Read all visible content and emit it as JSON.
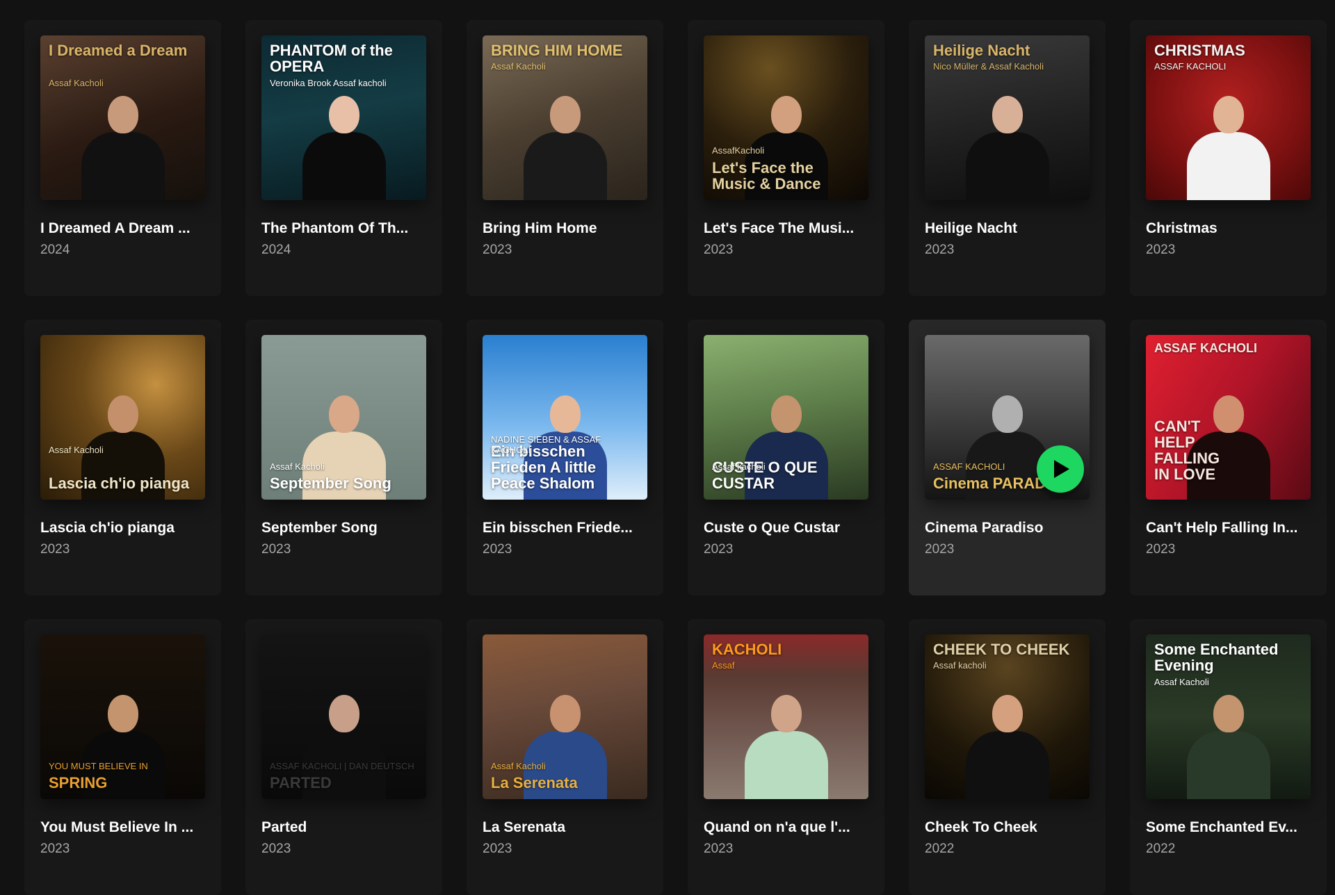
{
  "albums": [
    {
      "title": "I Dreamed A Dream ...",
      "year": "2024",
      "cover_text": "I Dreamed a Dream",
      "cover_sub": "Assaf Kacholi",
      "bg": "linear-gradient(160deg,#5a4030 0%,#2a1a12 55%,#15100c 100%)",
      "text_color": "#d9b56a",
      "skin": "#c79a7c",
      "suit": "#111111",
      "text_pos": "top"
    },
    {
      "title": "The Phantom Of Th...",
      "year": "2024",
      "cover_text": "PHANTOM of the OPERA",
      "cover_sub": "Veronika Brook   Assaf kacholi",
      "bg": "linear-gradient(170deg,#0d2a33 0%,#143c44 45%,#081a20 100%)",
      "text_color": "#ffffff",
      "skin": "#e8c0a8",
      "suit": "#0b0b0b",
      "text_pos": "top"
    },
    {
      "title": "Bring Him Home",
      "year": "2023",
      "cover_text": "BRING HIM HOME",
      "cover_sub": "Assaf Kacholi",
      "bg": "linear-gradient(160deg,#7a6a55 0%,#4a3e30 50%,#2a241c 100%)",
      "text_color": "#e0c070",
      "skin": "#c79a7c",
      "suit": "#1a1a1a",
      "text_pos": "top"
    },
    {
      "title": "Let's Face The Musi...",
      "year": "2023",
      "cover_text": "Let's Face the Music & Dance",
      "cover_sub": "AssafKacholi",
      "bg": "radial-gradient(circle at 40% 20%,#6a5020 0%,#2a1e0c 50%,#0c0804 100%)",
      "text_color": "#e6d2a0",
      "skin": "#d2a07e",
      "suit": "#0a0a0a",
      "text_pos": "bottom"
    },
    {
      "title": "Heilige Nacht",
      "year": "2023",
      "cover_text": "Heilige Nacht",
      "cover_sub": "Nico Müller & Assaf Kacholi",
      "bg": "linear-gradient(170deg,#3a3a3a 0%,#1e1e1e 60%,#0e0e0e 100%)",
      "text_color": "#d9b56a",
      "skin": "#d8b098",
      "suit": "#0f0f0f",
      "text_pos": "top"
    },
    {
      "title": "Christmas",
      "year": "2023",
      "cover_text": "CHRISTMAS",
      "cover_sub": "ASSAF KACHOLI",
      "bg": "radial-gradient(circle at 50% 40%,#b22020 0%,#7a1010 60%,#4a0808 100%)",
      "text_color": "#f4f4f4",
      "skin": "#e0b494",
      "suit": "#f2f2f2",
      "text_pos": "top"
    },
    {
      "title": "Lascia ch'io pianga",
      "year": "2023",
      "cover_text": "Lascia ch'io pianga",
      "cover_sub": "Assaf Kacholi",
      "bg": "radial-gradient(circle at 70% 30%,#c49040 0%,#6a4818 45%,#2a1c08 100%)",
      "text_color": "#f0e6c8",
      "skin": "#c4906c",
      "suit": "#141008",
      "text_pos": "bottom"
    },
    {
      "title": "September Song",
      "year": "2023",
      "cover_text": "September Song",
      "cover_sub": "Assaf Kacholi",
      "bg": "linear-gradient(180deg,#8a9a94 0%,#6d7f78 100%)",
      "text_color": "#ffffff",
      "skin": "#d8a888",
      "suit": "#e6d3b6",
      "text_pos": "bottom"
    },
    {
      "title": "Ein bisschen Friede...",
      "year": "2023",
      "cover_text": "Ein bisschen Frieden A little Peace Shalom",
      "cover_sub": "NADINE SIEBEN & ASSAF KACHOLI",
      "bg": "linear-gradient(180deg,#2a7fd0 0%,#7ab8ee 55%,#dfeefa 100%)",
      "text_color": "#ffffff",
      "skin": "#e6b898",
      "suit": "#2c4e9a",
      "text_pos": "bottom"
    },
    {
      "title": "Custe o Que Custar",
      "year": "2023",
      "cover_text": "CUSTE O QUE CUSTAR",
      "cover_sub": "Assaf kacholi",
      "bg": "linear-gradient(170deg,#8ab070 0%,#5e7e4a 45%,#2a3a22 100%)",
      "text_color": "#ffffff",
      "skin": "#c4946e",
      "suit": "#1a2a4e",
      "text_pos": "bottom"
    },
    {
      "title": "Cinema Paradiso",
      "year": "2023",
      "cover_text": "Cinema PARADISO",
      "cover_sub": "ASSAF KACHOLI",
      "bg": "linear-gradient(180deg,#6a6a6a 0%,#3a3a3a 55%,#141414 100%)",
      "text_color": "#e8c060",
      "skin": "#b0b0b0",
      "suit": "#181818",
      "text_pos": "bottom"
    },
    {
      "title": "Can't Help Falling In...",
      "year": "2023",
      "cover_text": "CAN'T HELP FALLING IN LOVE",
      "cover_sub": "ASSAF KACHOLI",
      "bg": "linear-gradient(120deg,#e02030 0%,#b01428 50%,#5a0a14 100%)",
      "text_color": "#f8e8e0",
      "skin": "#d09070",
      "suit": "#1a0a0a",
      "text_pos": "middle"
    },
    {
      "title": "You Must Believe In ...",
      "year": "2023",
      "cover_text": "SPRING",
      "cover_sub": "YOU MUST BELIEVE IN",
      "bg": "linear-gradient(180deg,#1a120a 0%,#0a0806 100%)",
      "text_color": "#e8a030",
      "skin": "#c4946e",
      "suit": "#0a0a0a",
      "text_pos": "bottom"
    },
    {
      "title": "Parted",
      "year": "2023",
      "cover_text": "PARTED",
      "cover_sub": "ASSAF KACHOLI | DAN DEUTSCH",
      "bg": "linear-gradient(180deg,#141414 0%,#0a0a0a 100%)",
      "text_color": "#3a3a3a",
      "skin": "#c8a08a",
      "suit": "#0e0e0e",
      "text_pos": "bottom"
    },
    {
      "title": "La Serenata",
      "year": "2023",
      "cover_text": "La Serenata",
      "cover_sub": "Assaf Kacholi",
      "bg": "linear-gradient(170deg,#8a5a3a 0%,#6a4a3a 40%,#3a2a20 100%)",
      "text_color": "#e8b040",
      "skin": "#c89270",
      "suit": "#2a4a8a",
      "text_pos": "bottom"
    },
    {
      "title": "Quand on n'a que l'...",
      "year": "2023",
      "cover_text": "KACHOLI",
      "cover_sub": "Assaf",
      "bg": "linear-gradient(180deg,#8a2a2a 0%,#5a3a32 25%,#8a7a70 100%)",
      "text_color": "#ff9a1a",
      "skin": "#d0a488",
      "suit": "#b8dcc0",
      "text_pos": "top"
    },
    {
      "title": "Cheek To Cheek",
      "year": "2022",
      "cover_text": "CHEEK TO CHEEK",
      "cover_sub": "Assaf kacholi",
      "bg": "radial-gradient(circle at 50% 20%,#5a4420 0%,#1e1608 60%,#0a0804 100%)",
      "text_color": "#e0d0a8",
      "skin": "#d4a07e",
      "suit": "#101010",
      "text_pos": "top"
    },
    {
      "title": "Some Enchanted Ev...",
      "year": "2022",
      "cover_text": "Some Enchanted Evening",
      "cover_sub": "Assaf Kacholi",
      "bg": "linear-gradient(180deg,#1e2a1e 0%,#2a3a26 50%,#121a12 100%)",
      "text_color": "#ffffff",
      "skin": "#c4946e",
      "suit": "#2a3a2a",
      "text_pos": "top"
    }
  ],
  "active_index": 10,
  "play_button": {
    "label": "play-icon",
    "color": "#1ed760"
  }
}
